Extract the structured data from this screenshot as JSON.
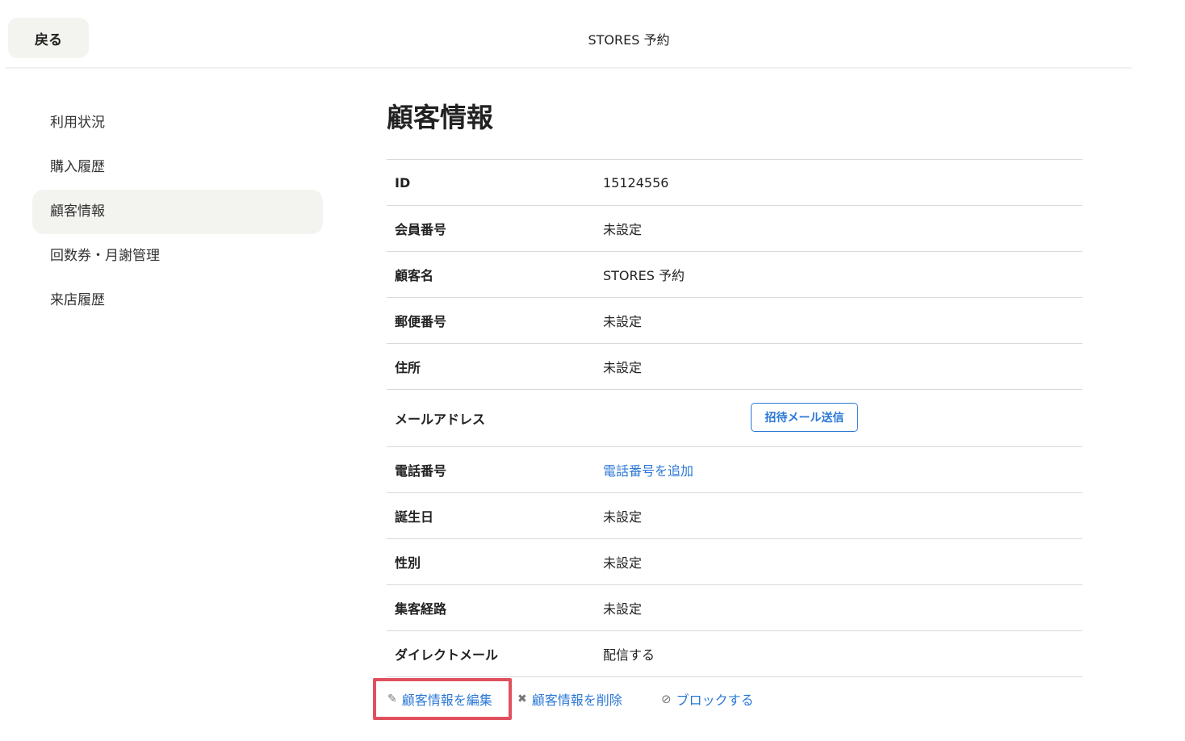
{
  "header": {
    "back_label": "戻る",
    "app_title": "STORES 予約"
  },
  "sidebar": {
    "items": [
      {
        "label": "利用状況"
      },
      {
        "label": "購入履歴"
      },
      {
        "label": "顧客情報",
        "active": true
      },
      {
        "label": "回数券・月謝管理"
      },
      {
        "label": "来店履歴"
      }
    ]
  },
  "main": {
    "title": "顧客情報",
    "rows": [
      {
        "label": "ID",
        "value": "15124556"
      },
      {
        "label": "会員番号",
        "value": "未設定"
      },
      {
        "label": "顧客名",
        "value": "STORES 予約"
      },
      {
        "label": "郵便番号",
        "value": "未設定"
      },
      {
        "label": "住所",
        "value": "未設定"
      },
      {
        "label": "メールアドレス",
        "value": "",
        "button": "招待メール送信"
      },
      {
        "label": "電話番号",
        "value": "電話番号を追加"
      },
      {
        "label": "誕生日",
        "value": "未設定"
      },
      {
        "label": "性別",
        "value": "未設定"
      },
      {
        "label": "集客経路",
        "value": "未設定"
      },
      {
        "label": "ダイレクトメール",
        "value": "配信する"
      }
    ]
  },
  "actions": {
    "edit": {
      "label": "顧客情報を編集",
      "icon": "pencil-icon"
    },
    "delete": {
      "label": "顧客情報を削除",
      "icon": "close-icon"
    },
    "block": {
      "label": "ブロックする",
      "icon": "block-icon"
    }
  },
  "colors": {
    "link": "#2b78d6",
    "highlight": "#e0505e",
    "active_bg": "#f3f3ef"
  }
}
